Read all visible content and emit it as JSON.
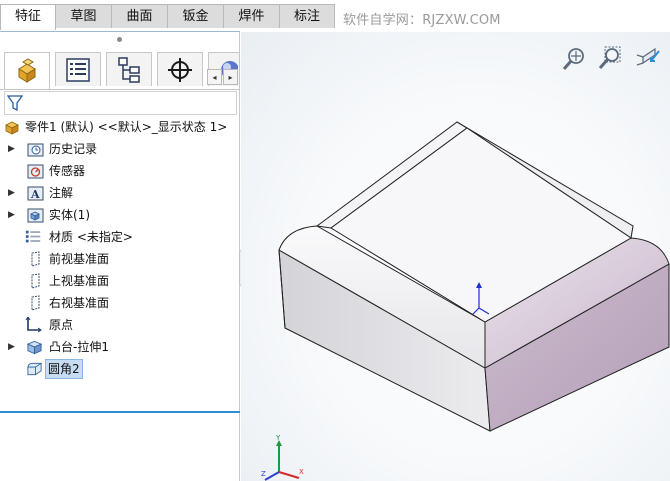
{
  "command_tabs": [
    "特征",
    "草图",
    "曲面",
    "钣金",
    "焊件",
    "标注"
  ],
  "active_tab_index": 0,
  "watermark": "软件自学网：RJZXW.COM",
  "panel_tabs": [
    {
      "icon": "feature-manager-icon"
    },
    {
      "icon": "property-manager-icon"
    },
    {
      "icon": "configuration-manager-icon"
    },
    {
      "icon": "dimxpert-manager-icon"
    },
    {
      "icon": "display-manager-icon"
    }
  ],
  "panel_scroll": {
    "left": "◂",
    "right": "▸"
  },
  "filter": {
    "icon": "filter-icon"
  },
  "tree": {
    "root": "零件1 (默认) <<默认>_显示状态 1>",
    "items": [
      {
        "label": "历史记录",
        "icon": "history-folder-icon",
        "expandable": true
      },
      {
        "label": "传感器",
        "icon": "sensors-icon",
        "expandable": false
      },
      {
        "label": "注解",
        "icon": "annotations-icon",
        "expandable": true
      },
      {
        "label": "实体(1)",
        "icon": "solid-bodies-icon",
        "expandable": true
      },
      {
        "label": "材质 <未指定>",
        "icon": "material-icon",
        "expandable": false
      },
      {
        "label": "前视基准面",
        "icon": "plane-icon",
        "expandable": false
      },
      {
        "label": "上视基准面",
        "icon": "plane-icon",
        "expandable": false
      },
      {
        "label": "右视基准面",
        "icon": "plane-icon",
        "expandable": false
      },
      {
        "label": "原点",
        "icon": "origin-icon",
        "expandable": false
      },
      {
        "label": "凸台-拉伸1",
        "icon": "extrude-icon",
        "expandable": true
      },
      {
        "label": "圆角2",
        "icon": "fillet-icon",
        "expandable": false,
        "selected": true
      }
    ]
  },
  "viewport": {
    "tools": [
      "zoom-to-fit-icon",
      "zoom-to-area-icon",
      "previous-view-icon"
    ],
    "triad": {
      "x": "X",
      "y": "Y",
      "z": "Z"
    }
  },
  "colors": {
    "selection": "#c7ddf3",
    "accent_line": "#2f8fd6",
    "part_top": "#f6f6f8",
    "part_side_left": "#dedee2",
    "part_side_right": "#bfaac1"
  }
}
